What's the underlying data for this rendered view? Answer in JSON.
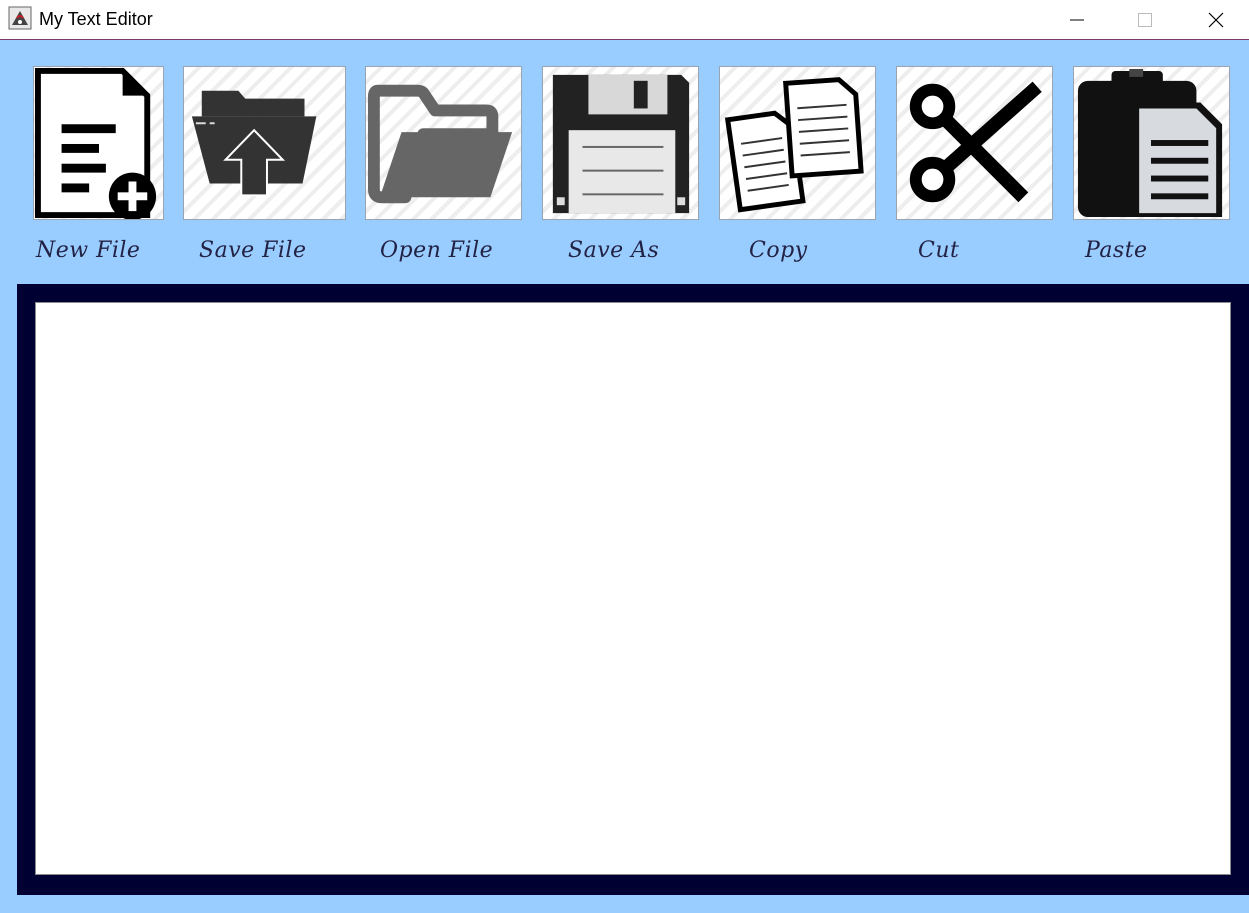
{
  "window": {
    "title": "My Text Editor",
    "controls": [
      "minimize",
      "maximize",
      "close"
    ]
  },
  "toolbar": {
    "buttons": [
      {
        "label": "New File",
        "icon": "new-file-icon"
      },
      {
        "label": "Save File",
        "icon": "folder-upload-icon"
      },
      {
        "label": "Open File",
        "icon": "open-folder-icon"
      },
      {
        "label": "Save As",
        "icon": "floppy-disk-icon"
      },
      {
        "label": "Copy",
        "icon": "copy-documents-icon"
      },
      {
        "label": "Cut",
        "icon": "scissors-icon"
      },
      {
        "label": "Paste",
        "icon": "clipboard-paste-icon"
      }
    ]
  },
  "editor": {
    "content": ""
  },
  "colors": {
    "background": "#99ccff",
    "editor_frame": "#000033",
    "editor_background": "#ffffff"
  }
}
